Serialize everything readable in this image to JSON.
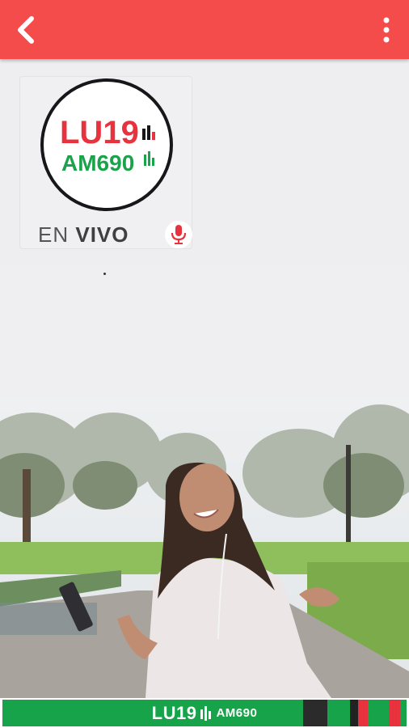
{
  "app_bar": {
    "back_icon": "chevron-left-icon",
    "menu_icon": "more-vertical-icon",
    "color": "#f44b4b"
  },
  "station": {
    "logo_main": "LU19",
    "logo_sub": "AM690",
    "live_prefix": "EN",
    "live_word": "VIVO",
    "mic_icon": "microphone-icon",
    "colors": {
      "red": "#e8333f",
      "green": "#1aa34a",
      "dark": "#16161b"
    }
  },
  "banner": {
    "text_main": "LU19",
    "text_sub": "AM690",
    "color": "#16a34a"
  }
}
